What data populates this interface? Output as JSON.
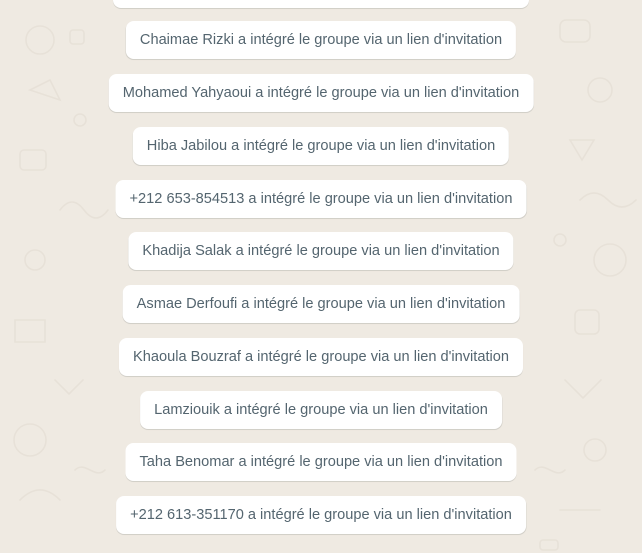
{
  "chat": {
    "system_messages": [
      {
        "text": "Chaimae Rizki a intégré le groupe via un lien d'invitation"
      },
      {
        "text": "Mohamed Yahyaoui a intégré le groupe via un lien d'invitation"
      },
      {
        "text": "Hiba Jabilou a intégré le groupe via un lien d'invitation"
      },
      {
        "text": "+212 653-854513 a intégré le groupe via un lien d'invitation"
      },
      {
        "text": "Khadija Salak a intégré le groupe via un lien d'invitation"
      },
      {
        "text": "Asmae Derfoufi a intégré le groupe via un lien d'invitation"
      },
      {
        "text": "Khaoula Bouzraf a intégré le groupe via un lien d'invitation"
      },
      {
        "text": "Lamziouik a intégré le groupe via un lien d'invitation"
      },
      {
        "text": "Taha Benomar a intégré le groupe via un lien d'invitation"
      },
      {
        "text": "+212 613-351170 a intégré le groupe via un lien d'invitation"
      }
    ]
  },
  "colors": {
    "wallpaper_background": "#efeae2",
    "bubble_background": "#ffffff",
    "bubble_text": "#54656f",
    "doodle_stroke": "#e3ddd3"
  }
}
